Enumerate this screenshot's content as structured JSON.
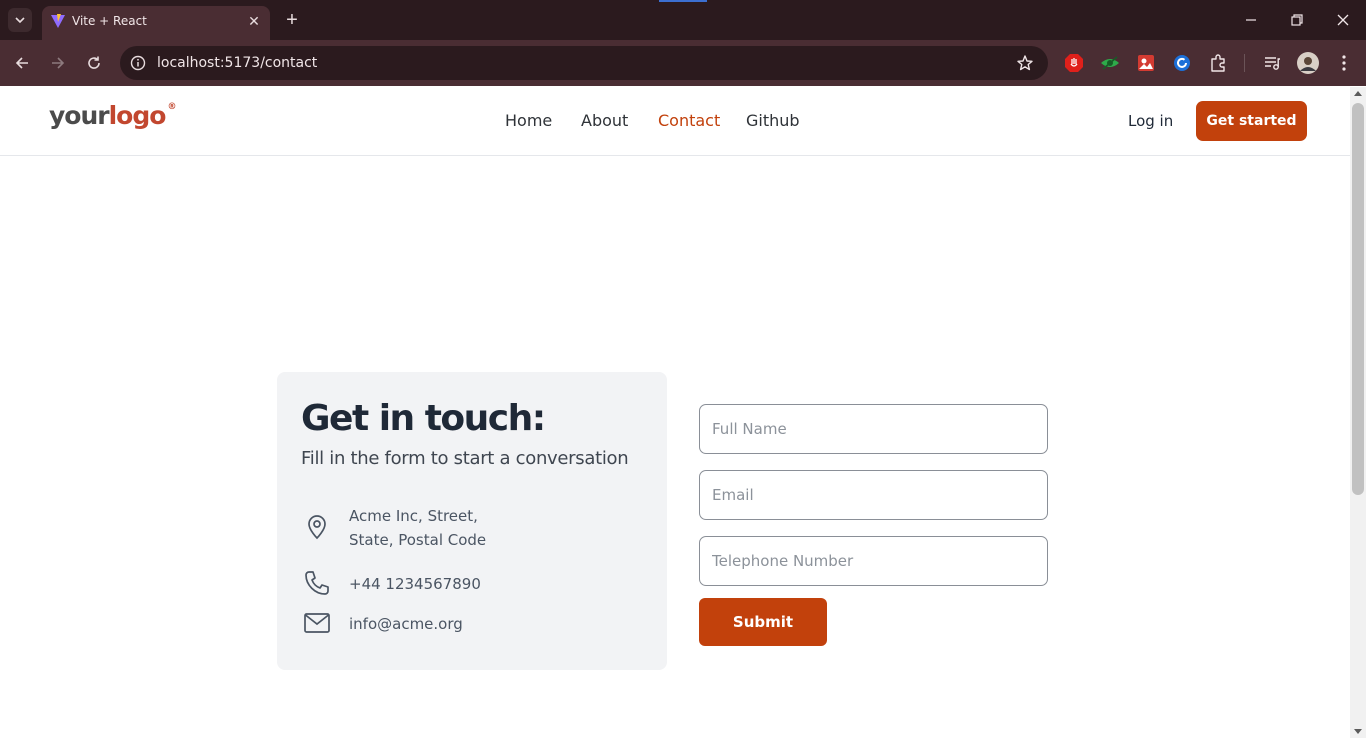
{
  "browser": {
    "tab_title": "Vite + React",
    "url": "localhost:5173/contact"
  },
  "site": {
    "logo": {
      "part1": "your",
      "part2": "logo",
      "mark": "®"
    },
    "nav": [
      {
        "label": "Home",
        "active": false
      },
      {
        "label": "About",
        "active": false
      },
      {
        "label": "Contact",
        "active": true
      },
      {
        "label": "Github",
        "active": false
      }
    ],
    "login_label": "Log in",
    "cta_label": "Get started"
  },
  "contact": {
    "title": "Get in touch:",
    "subtitle": "Fill in the form to start a conversation",
    "address_line1": "Acme Inc, Street,",
    "address_line2": "State, Postal Code",
    "phone": "+44 1234567890",
    "email": "info@acme.org"
  },
  "form": {
    "name_placeholder": "Full Name",
    "email_placeholder": "Email",
    "phone_placeholder": "Telephone Number",
    "submit_label": "Submit"
  },
  "colors": {
    "accent": "#c2410c",
    "chrome_dark": "#2b1a1e",
    "chrome_toolbar": "#4a2d33"
  },
  "icons": {
    "address": "map-pin-icon",
    "phone": "phone-icon",
    "email": "mail-icon"
  }
}
